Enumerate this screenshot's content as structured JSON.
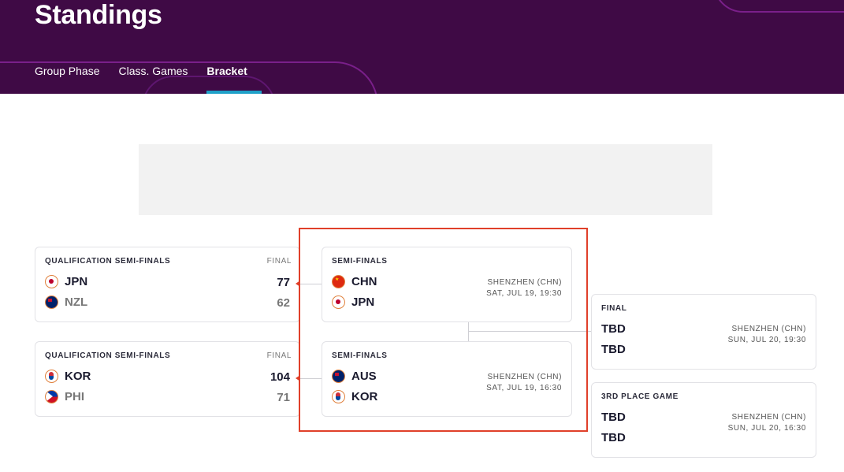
{
  "header": {
    "title": "Standings",
    "tabs": [
      {
        "label": "Group Phase"
      },
      {
        "label": "Class. Games"
      },
      {
        "label": "Bracket"
      }
    ],
    "active_tab": "Bracket"
  },
  "qualification": [
    {
      "label": "QUALIFICATION SEMI-FINALS",
      "status": "FINAL",
      "team1": {
        "name": "JPN",
        "score": "77",
        "flag": "japan-flag-icon"
      },
      "team2": {
        "name": "NZL",
        "score": "62",
        "flag": "new-zealand-flag-icon"
      }
    },
    {
      "label": "QUALIFICATION SEMI-FINALS",
      "status": "FINAL",
      "team1": {
        "name": "KOR",
        "score": "104",
        "flag": "korea-flag-icon"
      },
      "team2": {
        "name": "PHI",
        "score": "71",
        "flag": "philippines-flag-icon"
      }
    }
  ],
  "semifinals": [
    {
      "label": "SEMI-FINALS",
      "team1": {
        "name": "CHN",
        "flag": "china-flag-icon"
      },
      "team2": {
        "name": "JPN",
        "flag": "japan-flag-icon"
      },
      "venue": "SHENZHEN (CHN)",
      "datetime": "SAT, JUL 19, 19:30"
    },
    {
      "label": "SEMI-FINALS",
      "team1": {
        "name": "AUS",
        "flag": "australia-flag-icon"
      },
      "team2": {
        "name": "KOR",
        "flag": "korea-flag-icon"
      },
      "venue": "SHENZHEN (CHN)",
      "datetime": "SAT, JUL 19, 16:30"
    }
  ],
  "finals": [
    {
      "label": "FINAL",
      "team1": "TBD",
      "team2": "TBD",
      "venue": "SHENZHEN (CHN)",
      "datetime": "SUN, JUL 20, 19:30"
    },
    {
      "label": "3RD PLACE GAME",
      "team1": "TBD",
      "team2": "TBD",
      "venue": "SHENZHEN (CHN)",
      "datetime": "SUN, JUL 20, 16:30"
    }
  ],
  "colors": {
    "header_bg": "#3f0a45",
    "tab_underline": "#1ea0c8",
    "highlight": "#e0402a"
  }
}
